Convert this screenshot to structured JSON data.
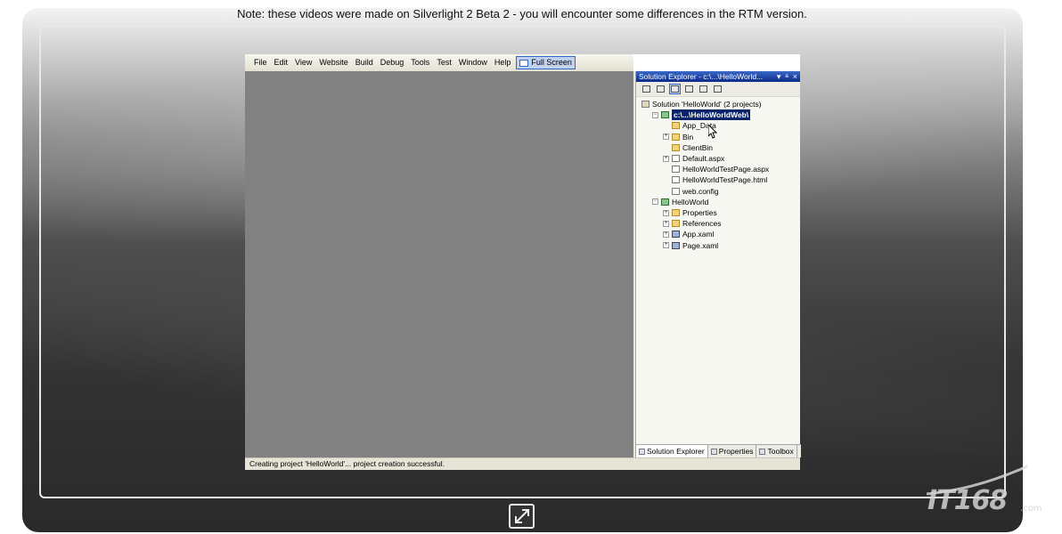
{
  "note": "Note: these videos were made on Silverlight 2 Beta 2 - you will encounter some differences in the RTM version.",
  "menu": [
    "File",
    "Edit",
    "View",
    "Website",
    "Build",
    "Debug",
    "Tools",
    "Test",
    "Window",
    "Help"
  ],
  "fullscreen_label": "Full Screen",
  "status": "Creating project 'HelloWorld'... project creation successful.",
  "solution_explorer": {
    "title": "Solution Explorer - c:\\...\\HelloWorld...",
    "title_buttons": [
      "▾",
      "ᵃ",
      "×"
    ],
    "tree": [
      {
        "label": "Solution 'HelloWorld' (2 projects)",
        "indent": 0,
        "expander": "",
        "icon": "sol"
      },
      {
        "label": "c:\\...\\HelloWorldWeb\\",
        "indent": 1,
        "expander": "−",
        "icon": "proj",
        "selected": true
      },
      {
        "label": "App_Data",
        "indent": 2,
        "expander": "",
        "icon": "folder"
      },
      {
        "label": "Bin",
        "indent": 2,
        "expander": "+",
        "icon": "folder"
      },
      {
        "label": "ClientBin",
        "indent": 2,
        "expander": "",
        "icon": "folder"
      },
      {
        "label": "Default.aspx",
        "indent": 2,
        "expander": "+",
        "icon": "file"
      },
      {
        "label": "HelloWorldTestPage.aspx",
        "indent": 2,
        "expander": "",
        "icon": "file"
      },
      {
        "label": "HelloWorldTestPage.html",
        "indent": 2,
        "expander": "",
        "icon": "file"
      },
      {
        "label": "web.config",
        "indent": 2,
        "expander": "",
        "icon": "file"
      },
      {
        "label": "HelloWorld",
        "indent": 1,
        "expander": "−",
        "icon": "proj"
      },
      {
        "label": "Properties",
        "indent": 2,
        "expander": "+",
        "icon": "folder"
      },
      {
        "label": "References",
        "indent": 2,
        "expander": "+",
        "icon": "folder"
      },
      {
        "label": "App.xaml",
        "indent": 2,
        "expander": "+",
        "icon": "gear"
      },
      {
        "label": "Page.xaml",
        "indent": 2,
        "expander": "+",
        "icon": "gear"
      }
    ],
    "tabs": [
      "Solution Explorer",
      "Properties",
      "Toolbox"
    ]
  },
  "logo": {
    "text": "IT168",
    "suffix": ".com"
  }
}
